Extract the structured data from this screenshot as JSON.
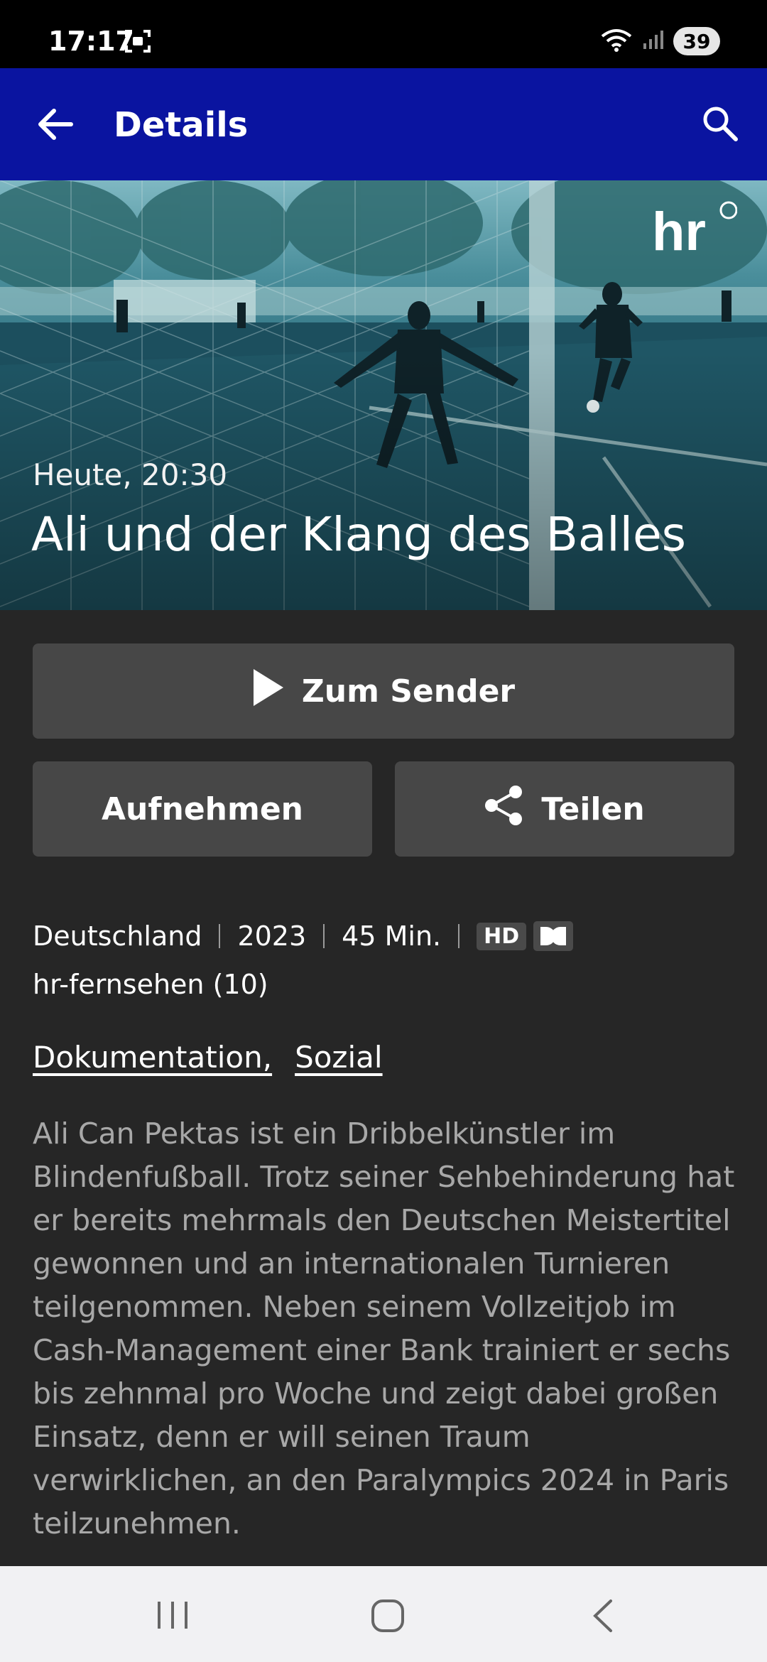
{
  "status_bar": {
    "time": "17:17",
    "battery": "39",
    "icons": [
      "screenshot-icon",
      "wifi-icon",
      "signal-icon"
    ]
  },
  "app_bar": {
    "title": "Details",
    "back_icon": "arrow-left-icon",
    "search_icon": "search-icon",
    "color": "#0a14a0"
  },
  "hero": {
    "broadcast_time": "Heute, 20:30",
    "title": "Ali und der Klang des Balles",
    "channel_logo": "hr"
  },
  "actions": {
    "live_label": "Zum Sender",
    "record_label": "Aufnehmen",
    "share_label": "Teilen"
  },
  "meta": {
    "country": "Deutschland",
    "year": "2023",
    "duration": "45 Min.",
    "hd_badge": "HD",
    "audio_badge_icon": "dolby-icon",
    "channel": "hr-fernsehen (10)"
  },
  "genres": [
    "Dokumentation,",
    "Sozial"
  ],
  "description": "Ali Can Pektas ist ein Dribbelkünstler im Blindenfußball. Trotz seiner Sehbehinderung hat er bereits mehrmals den Deutschen Meistertitel gewonnen und an internationalen Turnieren teilgenommen. Neben seinem Vollzeitjob im Cash-Management einer Bank trainiert er sechs bis zehnmal pro Woche und zeigt dabei großen Einsatz, denn er will seinen Traum verwirklichen, an den Paralympics 2024 in Paris teilzunehmen.",
  "nav_bar": {
    "icons": [
      "recents-icon",
      "home-icon",
      "back-icon"
    ]
  }
}
